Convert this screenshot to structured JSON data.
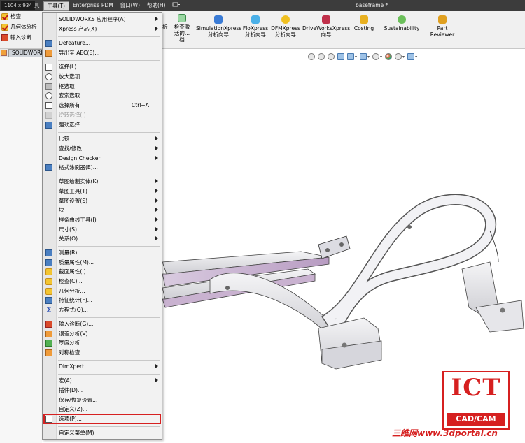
{
  "window": {
    "size_badge": "1104 x 934",
    "document_title": "baseframe *",
    "menubar": [
      {
        "label": "具",
        "active": false
      },
      {
        "label": "工具(T)",
        "active": true
      },
      {
        "label": "Enterprise PDM",
        "active": false
      },
      {
        "label": "窗口(W)",
        "active": false
      },
      {
        "label": "帮助(H)",
        "active": false
      },
      {
        "label": "",
        "active": false
      }
    ]
  },
  "left_tools": {
    "items": [
      {
        "label": "检查",
        "icon": "check-icon"
      },
      {
        "label": "几何体分析",
        "icon": "geometry-analysis-icon"
      },
      {
        "label": "输入诊断",
        "icon": "import-diagnostics-icon"
      }
    ],
    "tab_label": "SOLIDWORKS"
  },
  "command_manager": {
    "partial_label": "析",
    "partial_tool": {
      "line1": "检查激",
      "line2": "活的...",
      "line3": "档"
    },
    "tools": [
      {
        "line1": "SimulationXpress",
        "line2": "分析向导",
        "icon": "simulationxpress-icon"
      },
      {
        "line1": "FloXpress",
        "line2": "分析向导",
        "icon": "floxpress-icon"
      },
      {
        "line1": "DFMXpress",
        "line2": "分析向导",
        "icon": "dfmxpress-icon"
      },
      {
        "line1": "DriveWorksXpress",
        "line2": "向导",
        "icon": "driveworksxpress-icon"
      },
      {
        "line1": "Costing",
        "line2": "",
        "icon": "costing-icon"
      },
      {
        "line1": "Sustainability",
        "line2": "",
        "icon": "sustainability-icon"
      },
      {
        "line1": "Part",
        "line2": "Reviewer",
        "icon": "part-reviewer-icon"
      }
    ]
  },
  "tools_menu": {
    "items": [
      {
        "label": "SOLIDWORKS 应用程序(A)",
        "submenu": true
      },
      {
        "label": "Xpress 产品(X)",
        "submenu": true
      },
      {
        "sep": true
      },
      {
        "label": "Defeature...",
        "icon": "defeature-icon"
      },
      {
        "label": "导出至 AEC(E)...",
        "icon": "export-aec-icon"
      },
      {
        "sep": true
      },
      {
        "label": "选择(L)",
        "icon": "select-icon"
      },
      {
        "label": "放大选项",
        "icon": "magnified-selection-icon"
      },
      {
        "label": "框选取",
        "icon": "box-select-icon"
      },
      {
        "label": "套索选取",
        "icon": "lasso-select-icon"
      },
      {
        "label": "选择所有",
        "icon": "select-all-icon",
        "shortcut": "Ctrl+A"
      },
      {
        "label": "逆转选择(I)",
        "icon": "invert-selection-icon",
        "disabled": true
      },
      {
        "label": "强劲选择...",
        "icon": "power-select-icon"
      },
      {
        "sep": true
      },
      {
        "label": "比较",
        "submenu": true
      },
      {
        "label": "查找/修改",
        "submenu": true
      },
      {
        "label": "Design Checker",
        "submenu": true
      },
      {
        "label": "格式涂刷器(E)...",
        "icon": "format-painter-icon"
      },
      {
        "sep": true
      },
      {
        "label": "草图绘制实体(K)",
        "submenu": true
      },
      {
        "label": "草图工具(T)",
        "submenu": true
      },
      {
        "label": "草图设置(S)",
        "submenu": true
      },
      {
        "label": "块",
        "submenu": true
      },
      {
        "label": "样条曲线工具(I)",
        "submenu": true
      },
      {
        "label": "尺寸(S)",
        "submenu": true
      },
      {
        "label": "关系(O)",
        "submenu": true
      },
      {
        "sep": true
      },
      {
        "label": "测量(R)...",
        "icon": "measure-icon"
      },
      {
        "label": "质量属性(M)...",
        "icon": "mass-properties-icon"
      },
      {
        "label": "截面属性(I)...",
        "icon": "section-properties-icon"
      },
      {
        "label": "检查(C)...",
        "icon": "check-icon"
      },
      {
        "label": "几何分析...",
        "icon": "geometry-analysis-icon"
      },
      {
        "label": "特征统计(F)...",
        "icon": "feature-statistics-icon"
      },
      {
        "label": "方程式(Q)...",
        "icon": "equations-icon"
      },
      {
        "sep": true
      },
      {
        "label": "输入诊断(G)...",
        "icon": "import-diagnostics-icon"
      },
      {
        "label": "误差分析(V)...",
        "icon": "deviation-analysis-icon"
      },
      {
        "label": "厚度分析...",
        "icon": "thickness-analysis-icon"
      },
      {
        "label": "对称检查...",
        "icon": "symmetry-check-icon"
      },
      {
        "sep": true
      },
      {
        "label": "DimXpert",
        "submenu": true
      },
      {
        "sep": true
      },
      {
        "label": "宏(A)",
        "submenu": true
      },
      {
        "label": "插件(D)..."
      },
      {
        "label": "保存/恢复设置..."
      },
      {
        "label": "自定义(Z)..."
      },
      {
        "label": "选项(P)...",
        "icon": "options-icon",
        "highlighted": true
      },
      {
        "sep": true
      },
      {
        "label": "自定义菜单(M)"
      }
    ]
  },
  "watermark": {
    "logo_text": "ICT",
    "logo_subtext": "CAD/CAM",
    "site_text": "三维网www.3dportal.cn"
  }
}
